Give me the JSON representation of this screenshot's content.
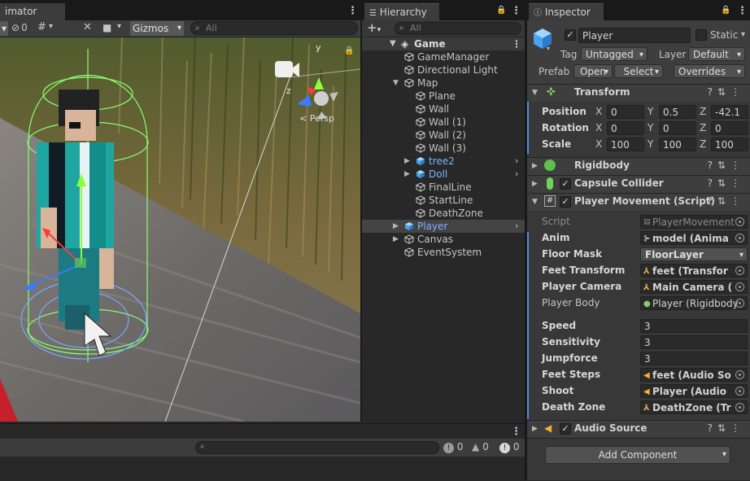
{
  "scene_panel": {
    "tab_label": "imator",
    "toolbar": {
      "hidden_count": "0",
      "gizmos_label": "Gizmos",
      "search_placeholder": "All"
    },
    "persp_label": "< Persp",
    "axis_y": "y",
    "axis_z": "z"
  },
  "hierarchy": {
    "tab_label": "Hierarchy",
    "add_label": "+",
    "search_placeholder": "All",
    "items": [
      {
        "label": "Game",
        "depth": 0,
        "expanded": true
      },
      {
        "label": "GameManager",
        "depth": 1
      },
      {
        "label": "Directional Light",
        "depth": 1
      },
      {
        "label": "Map",
        "depth": 1,
        "expanded": true
      },
      {
        "label": "Plane",
        "depth": 2
      },
      {
        "label": "Wall",
        "depth": 2
      },
      {
        "label": "Wall (1)",
        "depth": 2
      },
      {
        "label": "Wall (2)",
        "depth": 2
      },
      {
        "label": "Wall (3)",
        "depth": 2
      },
      {
        "label": "tree2",
        "depth": 2,
        "prefab": true,
        "collapsed": true
      },
      {
        "label": "Doll",
        "depth": 2,
        "prefab": true,
        "collapsed": true
      },
      {
        "label": "FinalLine",
        "depth": 2
      },
      {
        "label": "StartLine",
        "depth": 2
      },
      {
        "label": "DeathZone",
        "depth": 2
      },
      {
        "label": "Player",
        "depth": 1,
        "prefab": true,
        "collapsed": true,
        "selected": true
      },
      {
        "label": "Canvas",
        "depth": 1,
        "collapsed": true
      },
      {
        "label": "EventSystem",
        "depth": 1
      }
    ]
  },
  "inspector": {
    "tab_label": "Inspector",
    "object_name": "Player",
    "static_label": "Static",
    "tag_label": "Tag",
    "tag_value": "Untagged",
    "layer_label": "Layer",
    "layer_value": "Default",
    "prefab_label": "Prefab",
    "open_label": "Open",
    "select_label": "Select",
    "overrides_label": "Overrides",
    "transform": {
      "title": "Transform",
      "position_label": "Position",
      "rotation_label": "Rotation",
      "scale_label": "Scale",
      "position": {
        "x": "0",
        "y": "0.5",
        "z": "-42.1"
      },
      "rotation": {
        "x": "0",
        "y": "0",
        "z": "0"
      },
      "scale": {
        "x": "100",
        "y": "100",
        "z": "100"
      }
    },
    "rigidbody_title": "Rigidbody",
    "capsule_title": "Capsule Collider",
    "script_component": {
      "title": "Player Movement (Script)",
      "script_label": "Script",
      "script_value": "PlayerMovement",
      "fields": [
        {
          "label": "Anim",
          "value": "model (Anima"
        },
        {
          "label": "Floor Mask",
          "value": "FloorLayer"
        },
        {
          "label": "Feet Transform",
          "value": "feet (Transfor"
        },
        {
          "label": "Player Camera",
          "value": "Main Camera ("
        },
        {
          "label": "Player Body",
          "value": "Player (Rigidbody"
        },
        {
          "label": "Speed",
          "value": "3"
        },
        {
          "label": "Sensitivity",
          "value": "3"
        },
        {
          "label": "Jumpforce",
          "value": "3"
        },
        {
          "label": "Feet Steps",
          "value": "feet (Audio So"
        },
        {
          "label": "Shoot",
          "value": "Player (Audio"
        },
        {
          "label": "Death Zone",
          "value": "DeathZone (Tr"
        }
      ]
    },
    "audio_title": "Audio Source",
    "add_component_label": "Add Component"
  },
  "console": {
    "log_count": "0",
    "warn_count": "0",
    "error_count": "0"
  },
  "colors": {
    "accent_blue": "#7bb4ff",
    "selected_row": "#444444",
    "panel_bg": "#383838"
  }
}
